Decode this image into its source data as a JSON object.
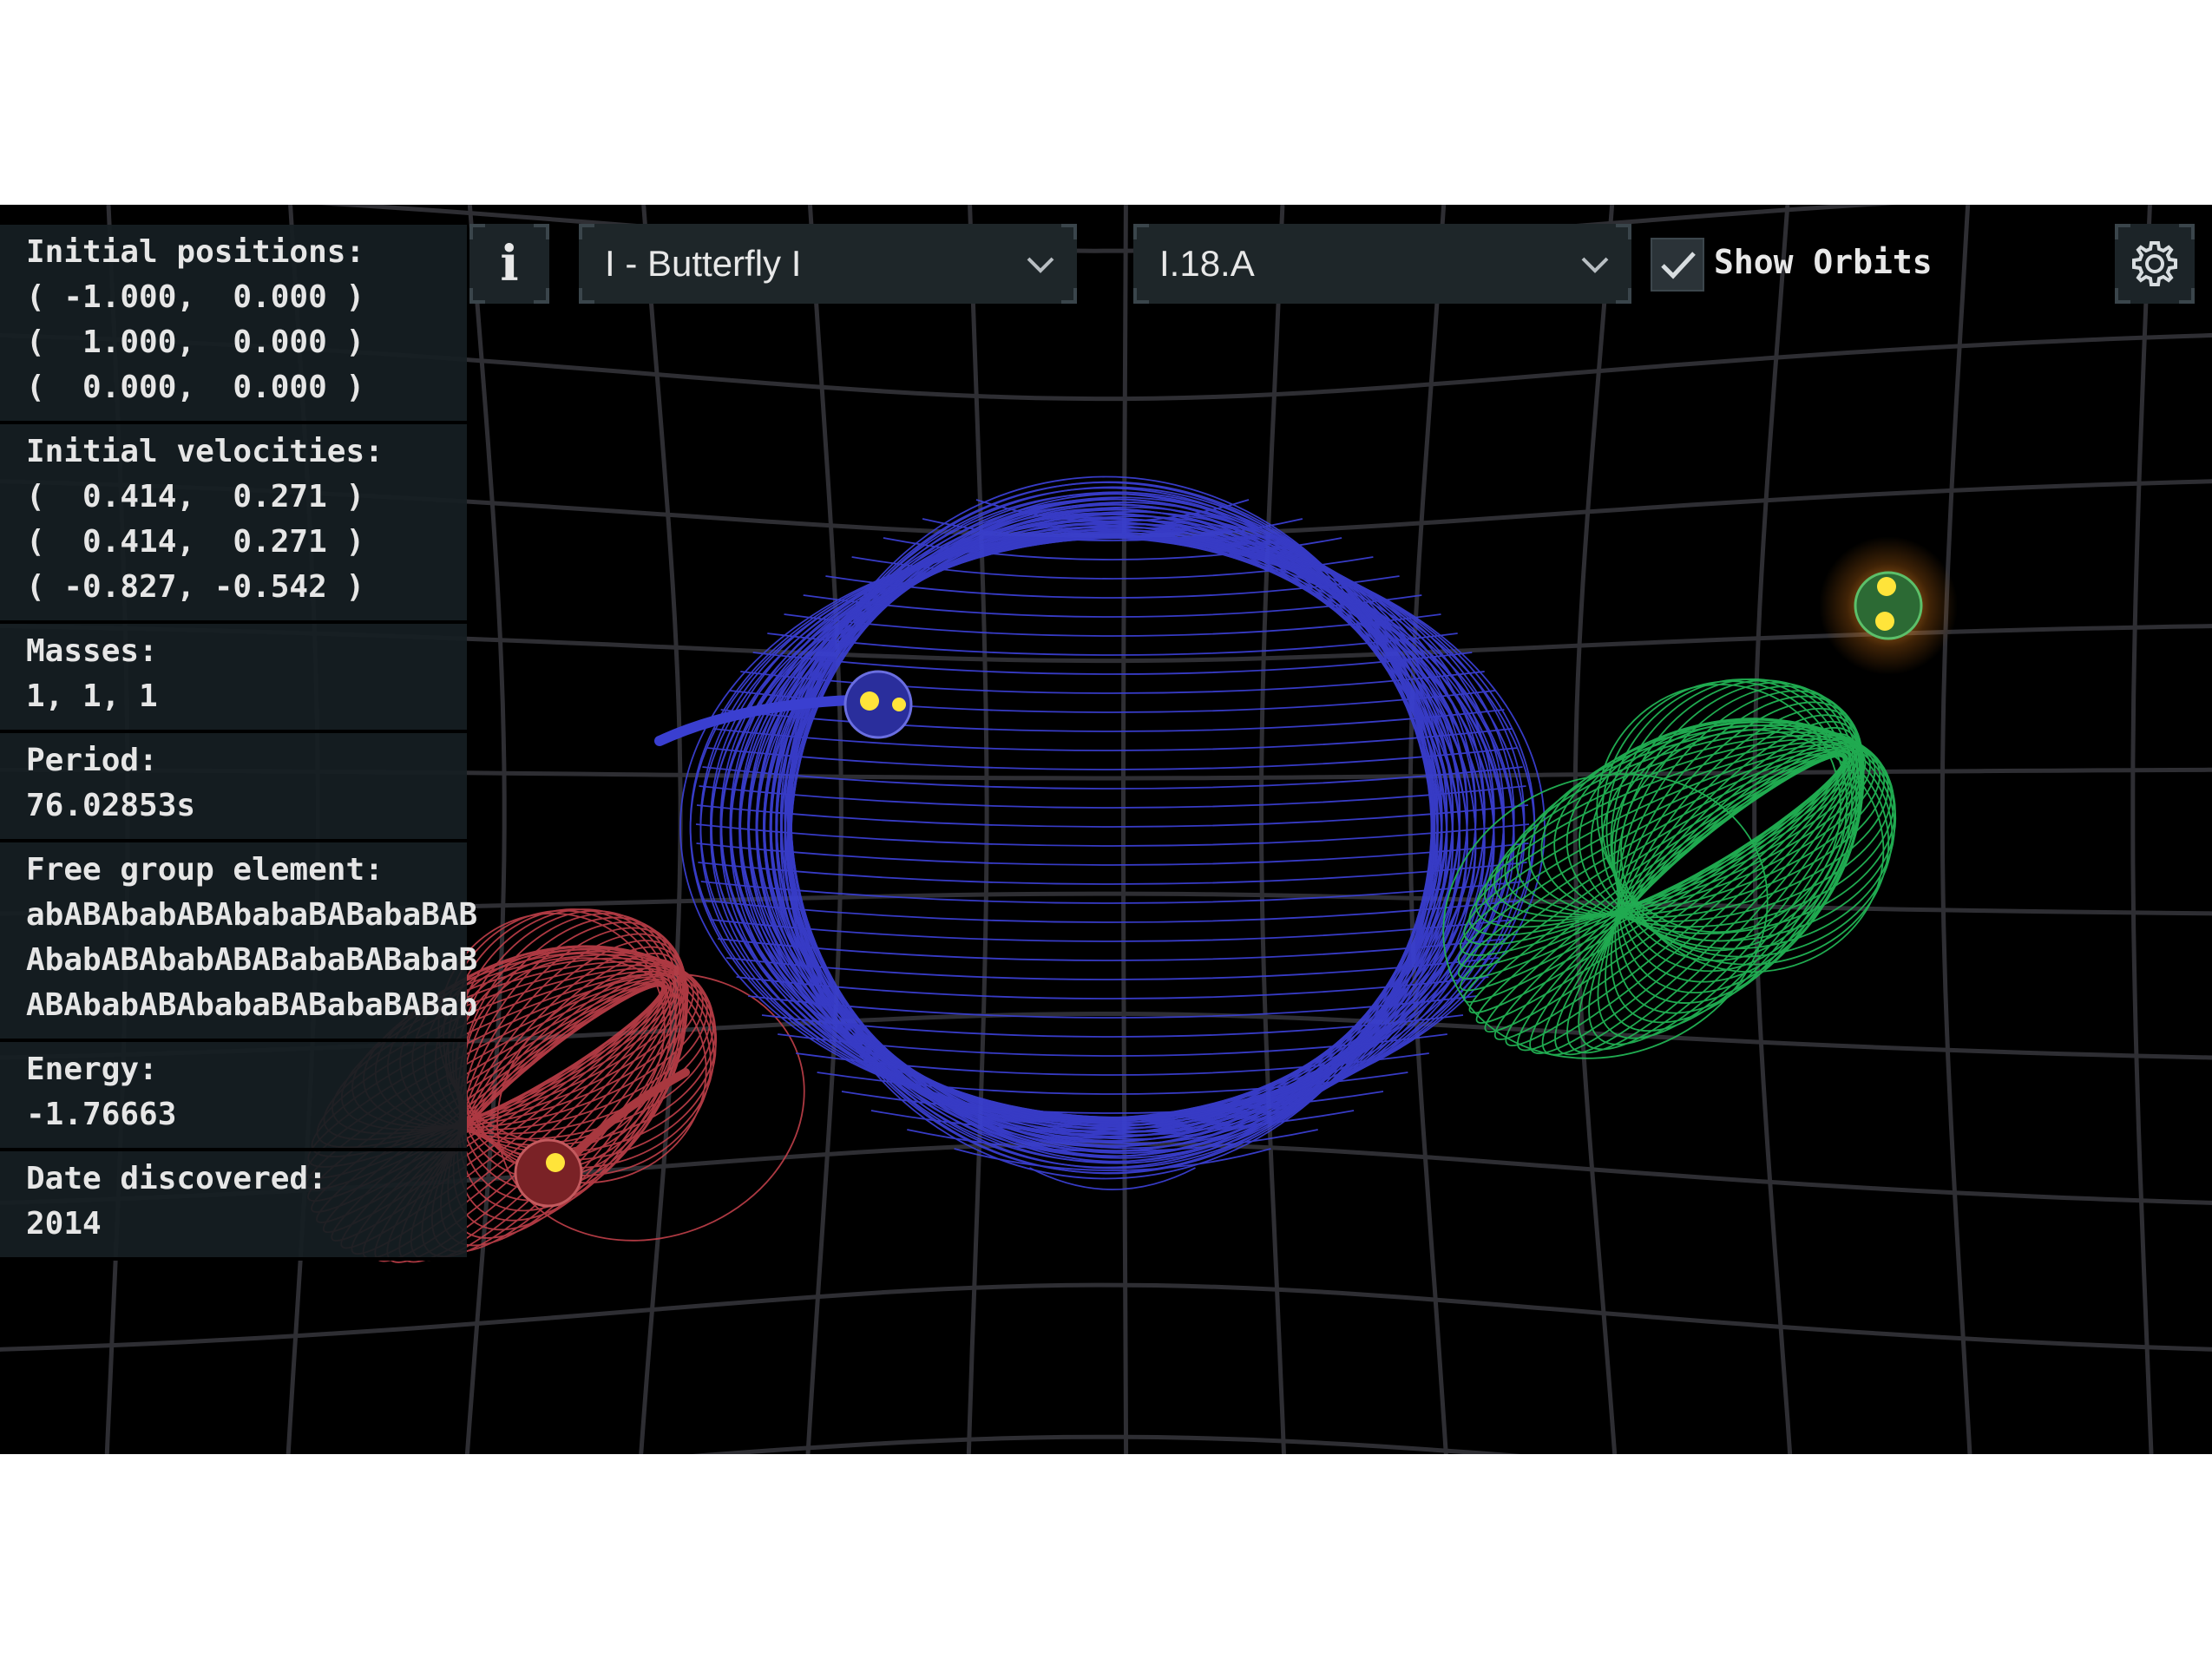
{
  "info": {
    "initial_positions": {
      "title": "Initial positions:",
      "rows": [
        "( -1.000,  0.000 )",
        "(  1.000,  0.000 )",
        "(  0.000,  0.000 )"
      ]
    },
    "initial_velocities": {
      "title": "Initial velocities:",
      "rows": [
        "(  0.414,  0.271 )",
        "(  0.414,  0.271 )",
        "( -0.827, -0.542 )"
      ]
    },
    "masses": {
      "title": "Masses:",
      "value": "1, 1, 1"
    },
    "period": {
      "title": "Period:",
      "value": "76.02853s"
    },
    "free_group": {
      "title": "Free group element:",
      "rows": [
        "abABAbabABAbabaBABabaBAB",
        "AbabABAbabABABabaBABabaB",
        "ABAbabABAbabaBABabaBABab"
      ]
    },
    "energy": {
      "title": "Energy:",
      "value": "-1.76663"
    },
    "date": {
      "title": "Date discovered:",
      "value": "2014"
    }
  },
  "toolbar": {
    "info_button_glyph": "i",
    "info_icon": "info-icon",
    "choreography": {
      "value": "I - Butterfly I",
      "icon": "chevron-down-icon"
    },
    "solution": {
      "value": "I.18.A",
      "icon": "chevron-down-icon"
    },
    "show_orbits": {
      "label": "Show Orbits",
      "checked": true,
      "icon": "checkmark-icon"
    },
    "settings_icon": "gear-icon"
  },
  "colors": {
    "background": "#000000",
    "grid": "#2e2e33",
    "orbit_red": "#c0404a",
    "orbit_blue": "#3a3fd0",
    "orbit_green": "#22b455",
    "panel": "#161e22",
    "text": "#e6e6e6"
  }
}
